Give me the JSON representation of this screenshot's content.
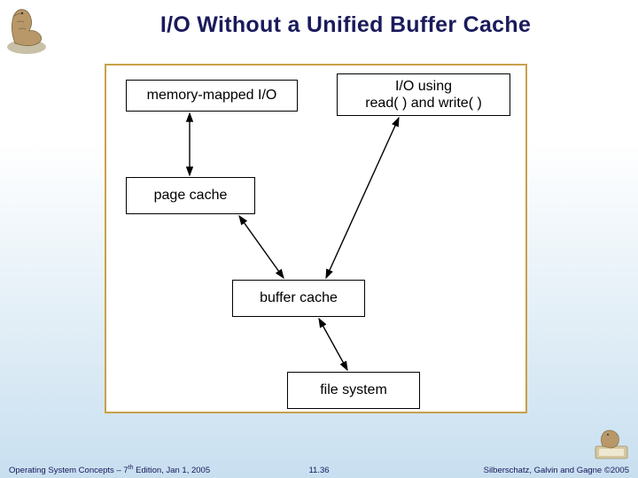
{
  "title": "I/O Without a Unified Buffer Cache",
  "diagram": {
    "boxes": {
      "mmio": "memory-mapped I/O",
      "rw": "I/O using\nread( ) and write( )",
      "pc": "page cache",
      "bc": "buffer cache",
      "fs": "file system"
    },
    "edges": [
      {
        "from": "mmio",
        "to": "pc",
        "bidirectional": true
      },
      {
        "from": "pc",
        "to": "bc",
        "bidirectional": true
      },
      {
        "from": "rw",
        "to": "bc",
        "bidirectional": true
      },
      {
        "from": "bc",
        "to": "fs",
        "bidirectional": true
      }
    ]
  },
  "footer": {
    "left_prefix": "Operating System Concepts – 7",
    "left_sup": "th",
    "left_suffix": " Edition, Jan 1, 2005",
    "center": "11.36",
    "right": "Silberschatz, Galvin and Gagne ©2005"
  },
  "icons": {
    "logo_top": "dinosaur-logo",
    "logo_bottom": "dinosaur-logo-small"
  }
}
